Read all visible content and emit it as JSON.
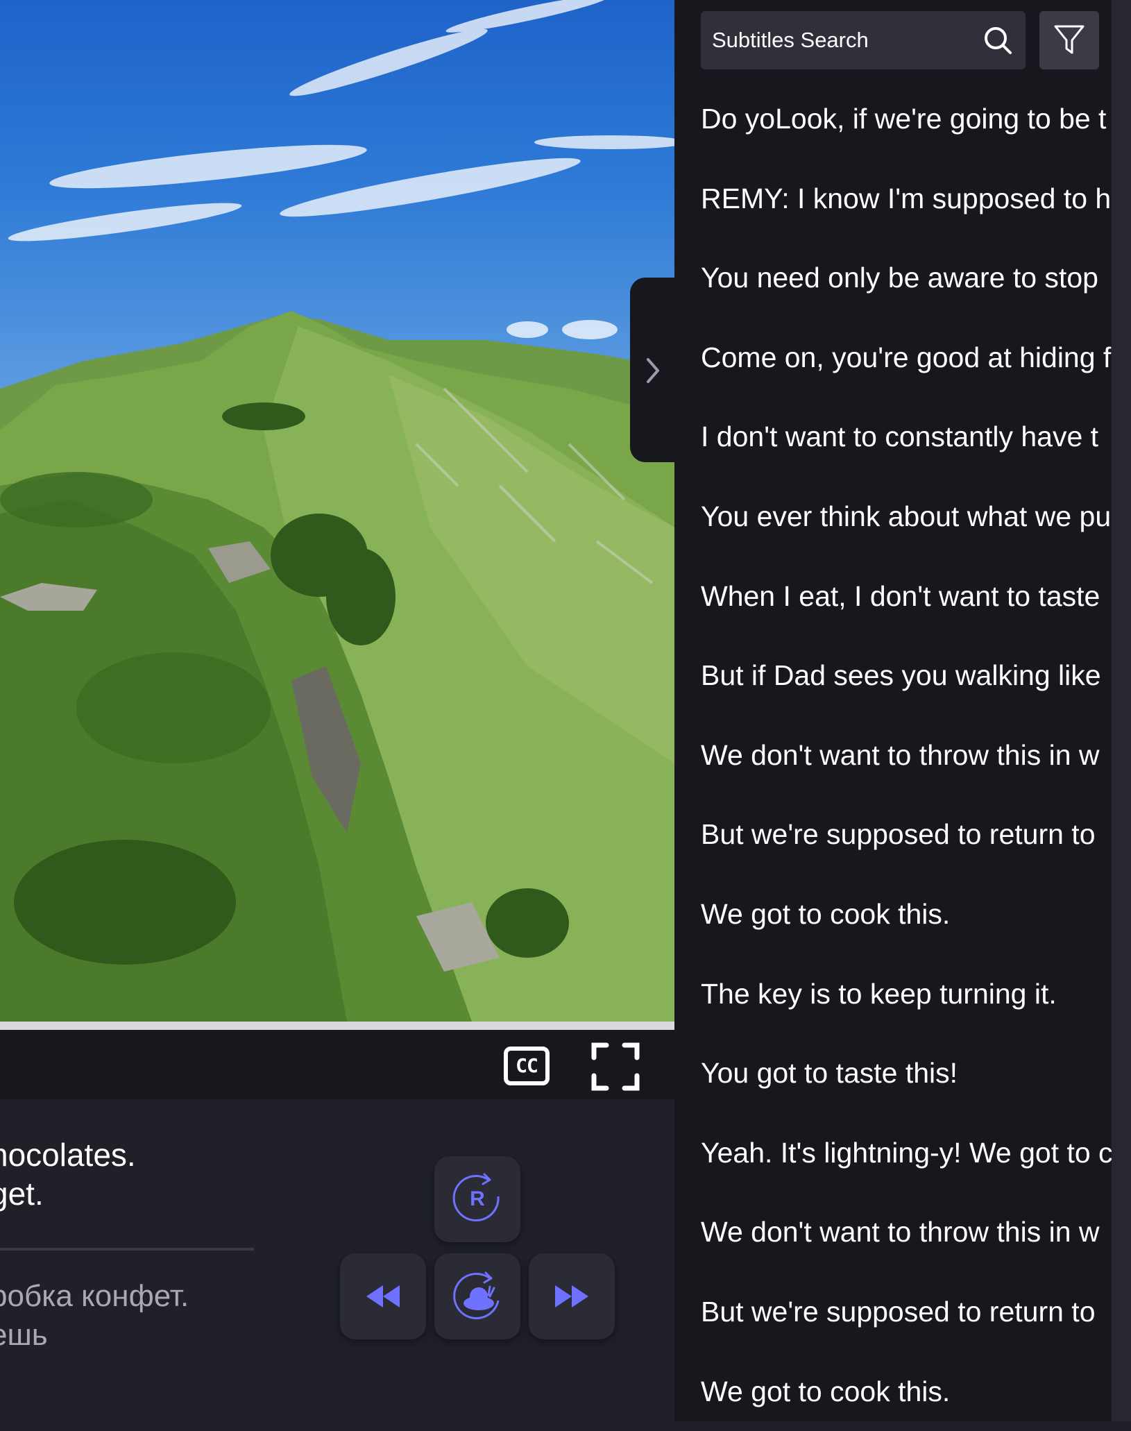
{
  "player": {
    "cc_label": "CC",
    "subtitle_en": [
      "hocolates.",
      "get."
    ],
    "subtitle_ru": [
      "робка конфет.",
      "ешь"
    ]
  },
  "panel": {
    "search": {
      "placeholder": "Subtitles Search",
      "value": ""
    },
    "subtitles": [
      "Do yoLook, if we're going to be t",
      "REMY: I know I'm supposed to h",
      "You need only be aware to stop",
      "Come on, you're good at hiding f",
      "I don't want to constantly have t",
      "You ever think about what we pu",
      "When I eat, I don't want to taste",
      "But if Dad sees you walking like",
      "We don't want to throw this in w",
      "But we're supposed to return to",
      "We got to cook this.",
      "The key is to keep turning it.",
      "You got to taste this!",
      "Yeah. It's lightning-y! We got to c",
      "We don't want to throw this in w",
      "But we're supposed to return to",
      "We got to cook this."
    ]
  },
  "controls": {
    "repeat_letter": "R"
  },
  "icons": {
    "search": "search-icon",
    "filter": "filter-icon",
    "cc": "closed-captions-icon",
    "fullscreen": "fullscreen-icon",
    "chevron": "chevron-right-icon",
    "repeat": "repeat-icon",
    "rewind": "rewind-icon",
    "slow": "snail-slow-replay-icon",
    "forward": "fast-forward-icon"
  },
  "colors": {
    "accent": "#6f72ff",
    "panel_bg": "#17181e",
    "page_bg": "#1f2028"
  }
}
